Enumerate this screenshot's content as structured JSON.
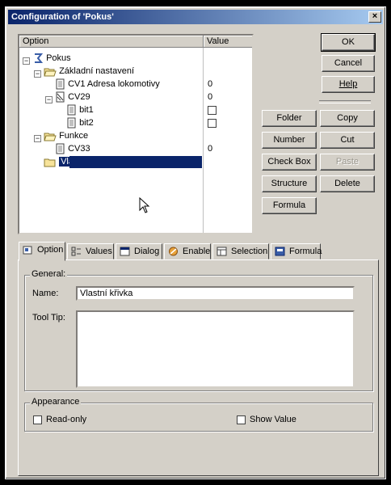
{
  "window": {
    "title": "Configuration of 'Pokus'",
    "close_glyph": "×"
  },
  "tree": {
    "headers": {
      "option": "Option",
      "value": "Value"
    },
    "nodes": [
      {
        "label": "Pokus",
        "icon": "root-icon",
        "expander": "−"
      },
      {
        "label": "Základní nastavení",
        "icon": "folder-open-icon",
        "expander": "−"
      },
      {
        "label": "CV1 Adresa lokomotivy",
        "icon": "document-icon",
        "value": "0"
      },
      {
        "label": "CV29",
        "icon": "document-bits-icon",
        "expander": "−",
        "value": "0"
      },
      {
        "label": "bit1",
        "icon": "document-icon",
        "checkbox": false
      },
      {
        "label": "bit2",
        "icon": "document-icon",
        "checkbox": false
      },
      {
        "label": "Funkce",
        "icon": "folder-open-icon",
        "expander": "−"
      },
      {
        "label": "CV33",
        "icon": "document-icon",
        "value": "0"
      },
      {
        "label": "Vlastní křivka",
        "icon": "folder-icon",
        "selected": true
      }
    ]
  },
  "buttons": {
    "ok": "OK",
    "cancel": "Cancel",
    "help": "Help",
    "folder": "Folder",
    "copy": "Copy",
    "number": "Number",
    "cut": "Cut",
    "checkbox": "Check Box",
    "paste": "Paste",
    "structure": "Structure",
    "delete": "Delete",
    "formula": "Formula"
  },
  "tabs": [
    "Option",
    "Values",
    "Dialog",
    "Enable",
    "Selection",
    "Formula"
  ],
  "general": {
    "legend": "General:",
    "name_label": "Name:",
    "name_value": "Vlastní křivka",
    "tooltip_label": "Tool Tip:",
    "tooltip_value": ""
  },
  "appearance": {
    "legend": "Appearance",
    "readonly_label": "Read-only",
    "show_value_label": "Show Value"
  }
}
